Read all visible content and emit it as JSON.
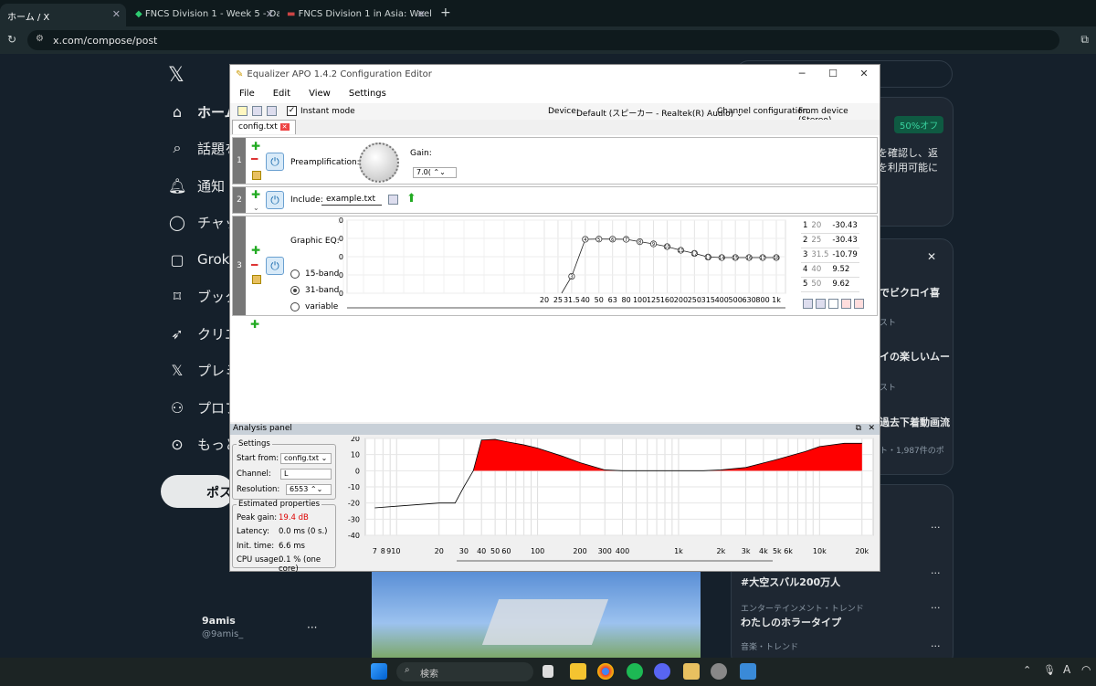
{
  "browser": {
    "tabs": [
      {
        "label": "ホーム / X"
      },
      {
        "label": "FNCS Division 1 - Week 5 - Day"
      },
      {
        "label": "FNCS Division 1 in Asia: Week 5"
      }
    ],
    "url": "x.com/compose/post"
  },
  "x_nav": {
    "items": [
      "ホーム",
      "話題を",
      "通知",
      "チャッ",
      "Grok",
      "ブック",
      "クリエ",
      "プレミ",
      "プロフ",
      "もっと"
    ],
    "post_button": "ポス",
    "user_name": "9amis",
    "user_handle": "@9amis_",
    "more": "···"
  },
  "x_right": {
    "search_box": "",
    "promo_badge": "50%オフ",
    "promo_line1": "を確認し、返",
    "promo_line2": "を利用可能に",
    "trend1": "でビクロイ喜",
    "trend1_meta": "スト",
    "trend2": "イの楽しいムー",
    "trend2_meta": "スト",
    "trend3": "過去下着動画流",
    "trend3_meta": "ト・1,987件のポ",
    "trend4": "#大空スバル200万人",
    "trend5_meta": "エンターテインメント・トレンド",
    "trend5": "わたしのホラータイプ",
    "trend6_meta": "音楽・トレンド",
    "close": "✕",
    "more": "···"
  },
  "window": {
    "title": "Equalizer APO 1.4.2 Configuration Editor",
    "menu": [
      "File",
      "Edit",
      "View",
      "Settings"
    ],
    "instant_mode": "Instant mode",
    "device_label": "Device:",
    "device_value": "Default (スピーカー - Realtek(R) Audio)",
    "channel_label": "Channel configuration:",
    "channel_value": "From device (Stereo)",
    "file_tab": "config.txt"
  },
  "row1": {
    "num": "1",
    "pre_label": "Preamplification:",
    "gain_label": "Gain:",
    "gain_value": "7.0("
  },
  "row2": {
    "num": "2",
    "include_label": "Include:",
    "include_value": "example.txt"
  },
  "row3": {
    "num": "3",
    "label": "Graphic EQ:",
    "band15": "15-band",
    "band31": "31-band",
    "variable": "variable",
    "y_ticks": [
      "20",
      "10",
      "0",
      "-10",
      "-20"
    ],
    "x_ticks": [
      "20",
      "25",
      "31.5",
      "40",
      "50",
      "63",
      "80",
      "100",
      "125",
      "160",
      "200",
      "250",
      "315",
      "400",
      "500",
      "630",
      "800",
      "1k"
    ],
    "table": [
      [
        "1",
        "20",
        "-30.43"
      ],
      [
        "2",
        "25",
        "-30.43"
      ],
      [
        "3",
        "31.5",
        "-10.79"
      ],
      [
        "4",
        "40",
        "9.52"
      ],
      [
        "5",
        "50",
        "9.62"
      ]
    ]
  },
  "chart_data": [
    {
      "type": "line",
      "title": "Graphic EQ",
      "x": [
        31.5,
        40,
        50,
        63,
        80,
        100,
        125,
        160,
        200,
        250,
        315,
        400,
        500,
        630,
        800,
        1000
      ],
      "values": [
        -10.79,
        9.52,
        9.62,
        9.6,
        9.5,
        8.2,
        7,
        5.5,
        3.5,
        1.8,
        -0.2,
        -0.5,
        -0.5,
        -0.5,
        -0.5,
        -0.5
      ],
      "point_labels": [
        "3",
        "4",
        "5",
        "6",
        "7",
        "8",
        "9",
        "10",
        "11",
        "12",
        "13",
        "14",
        "15",
        "16",
        "17",
        "18"
      ],
      "ylim": [
        -20,
        20
      ],
      "grid": true
    },
    {
      "type": "area",
      "title": "Analysis panel",
      "x": [
        7,
        10,
        20,
        26,
        30,
        35,
        40,
        50,
        60,
        80,
        100,
        150,
        200,
        300,
        400,
        600,
        1000,
        1500,
        2000,
        3000,
        5000,
        8000,
        10000,
        15000,
        20000
      ],
      "values": [
        -23,
        -22,
        -20,
        -20,
        -10,
        0,
        19,
        19.4,
        18,
        16,
        14,
        9,
        5,
        0.5,
        0,
        0,
        0,
        0,
        0.5,
        2,
        7,
        12,
        15,
        17,
        17
      ],
      "ylim": [
        -40,
        20
      ],
      "grid": true
    }
  ],
  "analysis": {
    "title": "Analysis panel",
    "settings_title": "Settings",
    "start_from_label": "Start from:",
    "start_from_value": "config.txt",
    "channel_label": "Channel:",
    "channel_value": "L",
    "resolution_label": "Resolution:",
    "resolution_value": "6553",
    "est_title": "Estimated properties",
    "peak_label": "Peak gain:",
    "peak_value": "19.4 dB",
    "latency_label": "Latency:",
    "latency_value": "0.0 ms (0 s.)",
    "init_label": "Init. time:",
    "init_value": "6.6 ms",
    "cpu_label": "CPU usage:",
    "cpu_value": "0.1 % (one core)",
    "y_ticks": [
      "20",
      "10",
      "0",
      "-10",
      "-20",
      "-30",
      "-40"
    ],
    "x_ticks": [
      "7",
      "8",
      "910",
      "20",
      "30",
      "40",
      "50",
      "60",
      "100",
      "200",
      "300",
      "400",
      "1k",
      "2k",
      "3k",
      "4k",
      "5k",
      "6k",
      "10k",
      "20k"
    ]
  },
  "taskbar": {
    "search": "検索"
  },
  "colors": {
    "accent": "#1d9bf0",
    "fill": "#ff0000"
  }
}
